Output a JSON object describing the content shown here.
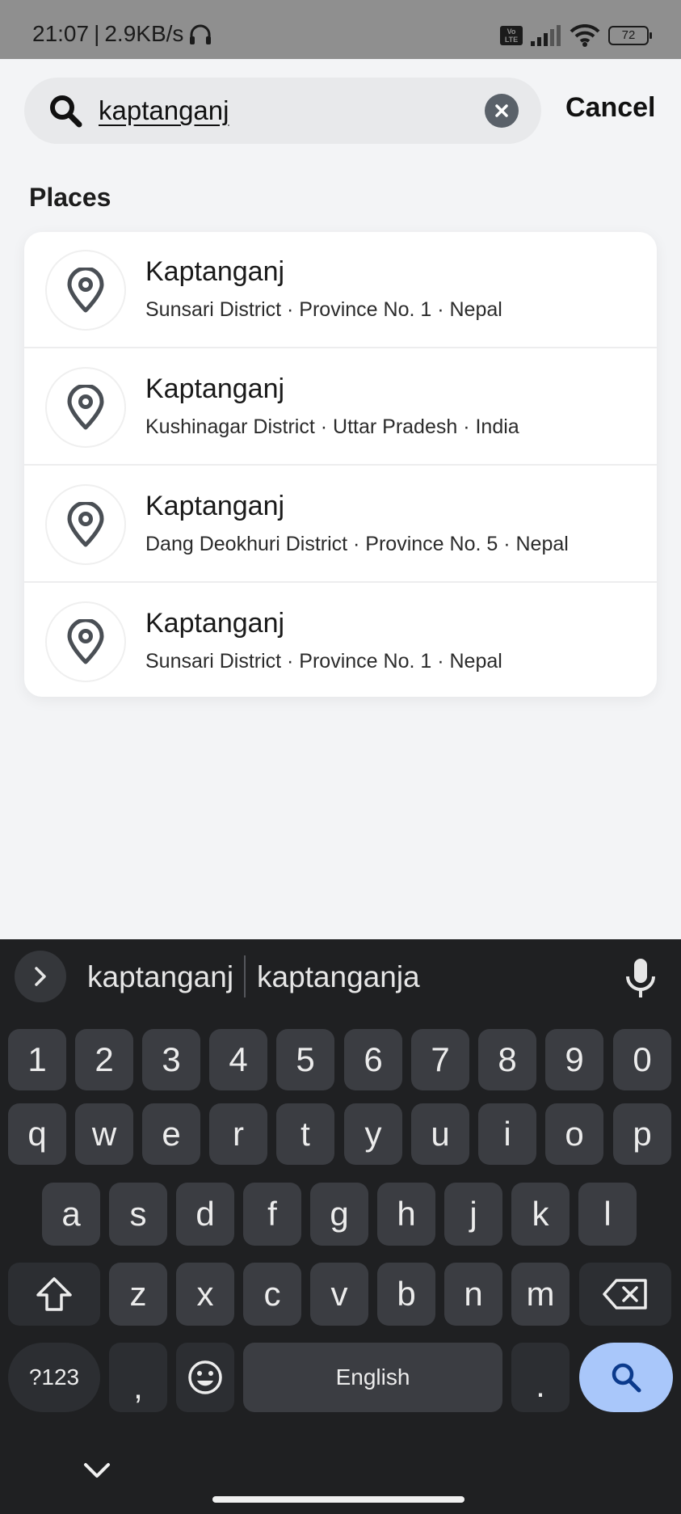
{
  "status_bar": {
    "time": "21:07",
    "net_speed": "2.9KB/s",
    "volte_label": "Vo LTE",
    "battery": "72"
  },
  "search": {
    "query": "kaptanganj",
    "cancel_label": "Cancel"
  },
  "section_title": "Places",
  "results": [
    {
      "title": "Kaptanganj",
      "subtitle": "Sunsari District · Province No. 1 · Nepal"
    },
    {
      "title": "Kaptanganj",
      "subtitle": "Kushinagar District · Uttar Pradesh · India"
    },
    {
      "title": "Kaptanganj",
      "subtitle": "Dang Deokhuri District · Province No. 5 · Nepal"
    },
    {
      "title": "Kaptanganj",
      "subtitle": "Sunsari District · Province No. 1 · Nepal"
    }
  ],
  "keyboard": {
    "suggestions": [
      "kaptanganj",
      "kaptanganja"
    ],
    "number_row": [
      "1",
      "2",
      "3",
      "4",
      "5",
      "6",
      "7",
      "8",
      "9",
      "0"
    ],
    "row1": [
      "q",
      "w",
      "e",
      "r",
      "t",
      "y",
      "u",
      "i",
      "o",
      "p"
    ],
    "row2": [
      "a",
      "s",
      "d",
      "f",
      "g",
      "h",
      "j",
      "k",
      "l"
    ],
    "row3": [
      "z",
      "x",
      "c",
      "v",
      "b",
      "n",
      "m"
    ],
    "symbols_label": "?123",
    "comma_label": ",",
    "space_label": "English",
    "period_label": "."
  },
  "colors": {
    "status_bar_bg": "#8f8f8f",
    "page_bg": "#f3f4f6",
    "keyboard_bg": "#1f2022",
    "search_key": "#a9c7fa"
  },
  "icons": [
    "search-icon",
    "clear-icon",
    "location-pin-icon",
    "chevron-right-icon",
    "microphone-icon",
    "shift-icon",
    "backspace-icon",
    "emoji-icon",
    "chevron-down-icon",
    "wifi-icon",
    "signal-icon",
    "headphones-icon"
  ]
}
